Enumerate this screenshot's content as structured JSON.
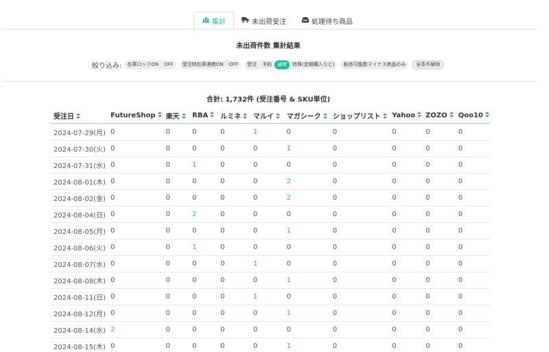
{
  "tabs": [
    {
      "label": "集計",
      "icon": "bar-chart-icon",
      "active": true
    },
    {
      "label": "未出荷受注",
      "icon": "truck-icon",
      "active": false
    },
    {
      "label": "処理待ち商品",
      "icon": "inbox-icon",
      "active": false
    }
  ],
  "subtitle": "未出荷件数 集計結果",
  "filters": {
    "label": "絞り込み:",
    "groups": [
      [
        {
          "label": "在庫ロックON",
          "on": false
        },
        {
          "label": "OFF",
          "on": false
        }
      ],
      [
        {
          "label": "受注時在庫連携ON",
          "on": false
        },
        {
          "label": "OFF",
          "on": false
        }
      ],
      [
        {
          "label": "受注",
          "on": false
        },
        {
          "label": "予約",
          "on": false
        },
        {
          "label": "通常",
          "on": true
        },
        {
          "label": "特殊(定期購入など)",
          "on": false
        }
      ],
      [
        {
          "label": "販売可能数マイナス商品のみ",
          "on": false
        }
      ]
    ],
    "reset_label": "全条件解除"
  },
  "total": "合計: 1,732件 (受注番号 & SKU単位)",
  "table": {
    "columns": [
      "受注日",
      "FutureShop",
      "楽天",
      "RBA",
      "ルミネ",
      "マルイ",
      "マガシーク",
      "ショップリスト",
      "Yahoo",
      "ZOZO",
      "Qoo10"
    ],
    "rows": [
      [
        "2024-07-29(月)",
        "0",
        "0",
        "0",
        "0",
        "1",
        "0",
        "0",
        "0",
        "0",
        "0"
      ],
      [
        "2024-07-30(火)",
        "0",
        "0",
        "0",
        "0",
        "0",
        "1",
        "0",
        "0",
        "0",
        "0"
      ],
      [
        "2024-07-31(水)",
        "0",
        "0",
        "1",
        "0",
        "0",
        "0",
        "0",
        "0",
        "0",
        "0"
      ],
      [
        "2024-08-01(木)",
        "0",
        "0",
        "0",
        "0",
        "0",
        "2",
        "0",
        "0",
        "0",
        "0"
      ],
      [
        "2024-08-02(金)",
        "0",
        "0",
        "0",
        "0",
        "0",
        "2",
        "0",
        "0",
        "0",
        "0"
      ],
      [
        "2024-08-04(日)",
        "0",
        "0",
        "2",
        "0",
        "0",
        "0",
        "0",
        "0",
        "0",
        "0"
      ],
      [
        "2024-08-05(月)",
        "0",
        "0",
        "0",
        "0",
        "0",
        "1",
        "0",
        "0",
        "0",
        "0"
      ],
      [
        "2024-08-06(火)",
        "0",
        "0",
        "1",
        "0",
        "0",
        "0",
        "0",
        "0",
        "0",
        "0"
      ],
      [
        "2024-08-07(水)",
        "0",
        "0",
        "0",
        "0",
        "1",
        "0",
        "0",
        "0",
        "0",
        "0"
      ],
      [
        "2024-08-08(木)",
        "0",
        "0",
        "0",
        "0",
        "0",
        "1",
        "0",
        "0",
        "0",
        "0"
      ],
      [
        "2024-08-11(日)",
        "0",
        "0",
        "0",
        "0",
        "1",
        "0",
        "0",
        "0",
        "0",
        "0"
      ],
      [
        "2024-08-12(月)",
        "0",
        "0",
        "0",
        "0",
        "0",
        "1",
        "0",
        "0",
        "0",
        "0"
      ],
      [
        "2024-08-14(水)",
        "2",
        "0",
        "0",
        "0",
        "0",
        "0",
        "0",
        "0",
        "0",
        "0"
      ],
      [
        "2024-08-15(木)",
        "0",
        "0",
        "0",
        "0",
        "0",
        "1",
        "0",
        "0",
        "0",
        "0"
      ]
    ]
  },
  "colors": {
    "accent": "#1abc9c",
    "sort_icon": "#3a7bd5"
  }
}
